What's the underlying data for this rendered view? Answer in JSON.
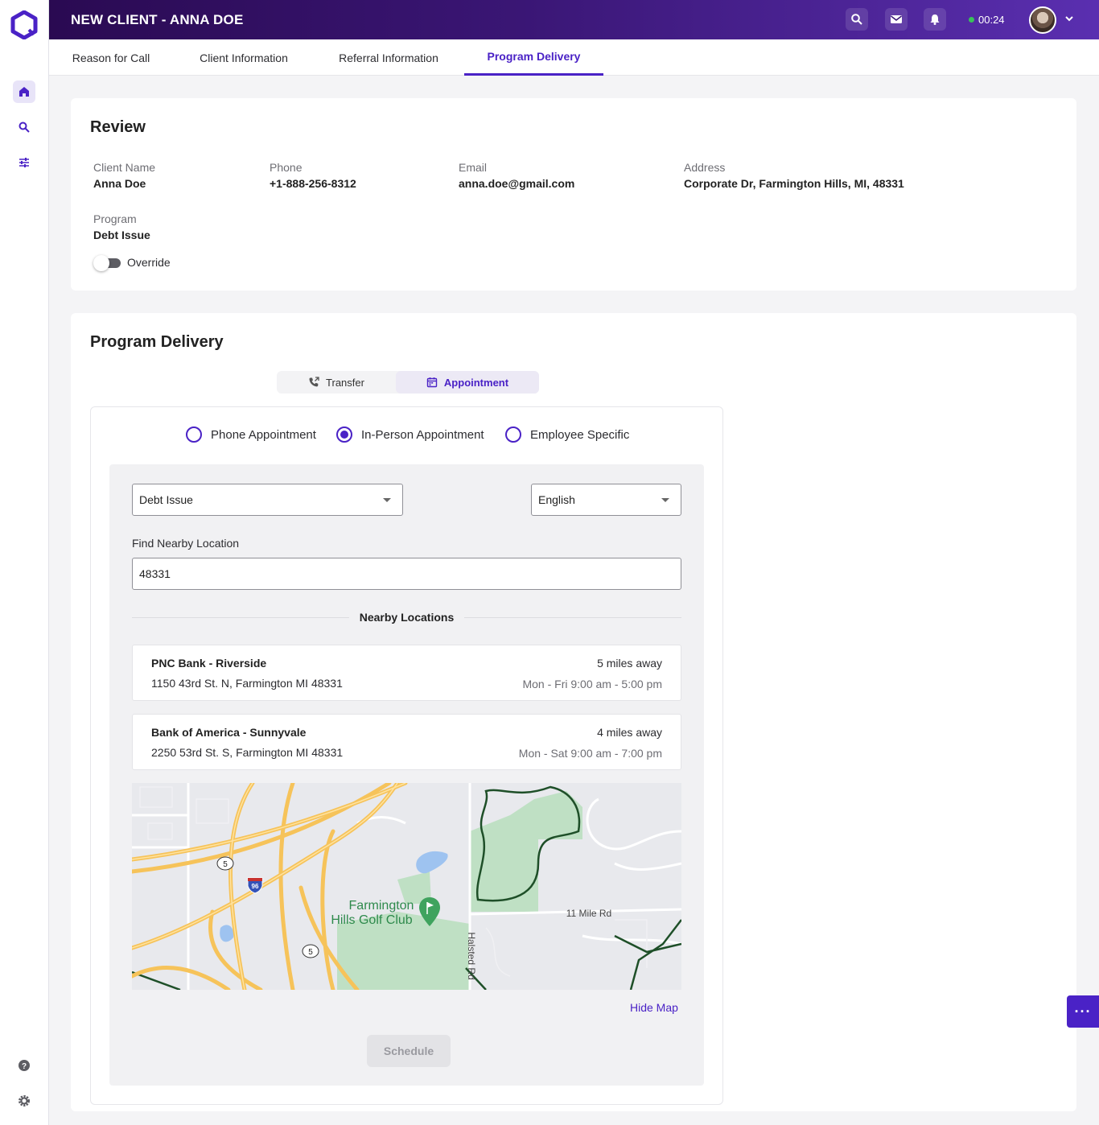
{
  "header": {
    "title": "NEW CLIENT - ANNA DOE",
    "timer": "00:24",
    "accent": "#4a22c6"
  },
  "tabs": [
    {
      "label": "Reason for Call",
      "active": false
    },
    {
      "label": "Client Information",
      "active": false
    },
    {
      "label": "Referral Information",
      "active": false
    },
    {
      "label": "Program Delivery",
      "active": true
    }
  ],
  "review": {
    "title": "Review",
    "client_name_label": "Client Name",
    "client_name": "Anna Doe",
    "phone_label": "Phone",
    "phone": "+1-888-256-8312",
    "email_label": "Email",
    "email": "anna.doe@gmail.com",
    "address_label": "Address",
    "address": "Corporate Dr, Farmington Hills, MI, 48331",
    "program_label": "Program",
    "program": "Debt Issue",
    "override_label": "Override"
  },
  "delivery": {
    "title": "Program Delivery",
    "segments": {
      "transfer": "Transfer",
      "appointment": "Appointment",
      "active": "appointment"
    },
    "radios": {
      "phone": "Phone Appointment",
      "in_person": "In-Person Appointment",
      "employee": "Employee Specific",
      "selected": "in_person"
    },
    "program_select": "Debt Issue",
    "language_select": "English",
    "find_label": "Find Nearby Location",
    "find_value": "48331",
    "nearby_title": "Nearby Locations",
    "locations": [
      {
        "name": "PNC Bank - Riverside",
        "address": "1150 43rd St. N, Farmington MI 48331",
        "distance": "5 miles away",
        "hours": "Mon - Fri 9:00 am - 5:00 pm"
      },
      {
        "name": "Bank of America - Sunnyvale",
        "address": "2250 53rd St. S, Farmington MI 48331",
        "distance": "4 miles away",
        "hours": "Mon - Sat 9:00 am - 7:00 pm"
      }
    ],
    "map": {
      "place_line1": "Farmington",
      "place_line2": "Hills Golf Club",
      "road_11mile": "11 Mile Rd",
      "road_halsted": "Halsted Rd",
      "shield_5": "5",
      "shield_96": "96"
    },
    "hide_map": "Hide Map",
    "schedule": "Schedule"
  },
  "fab": "···"
}
